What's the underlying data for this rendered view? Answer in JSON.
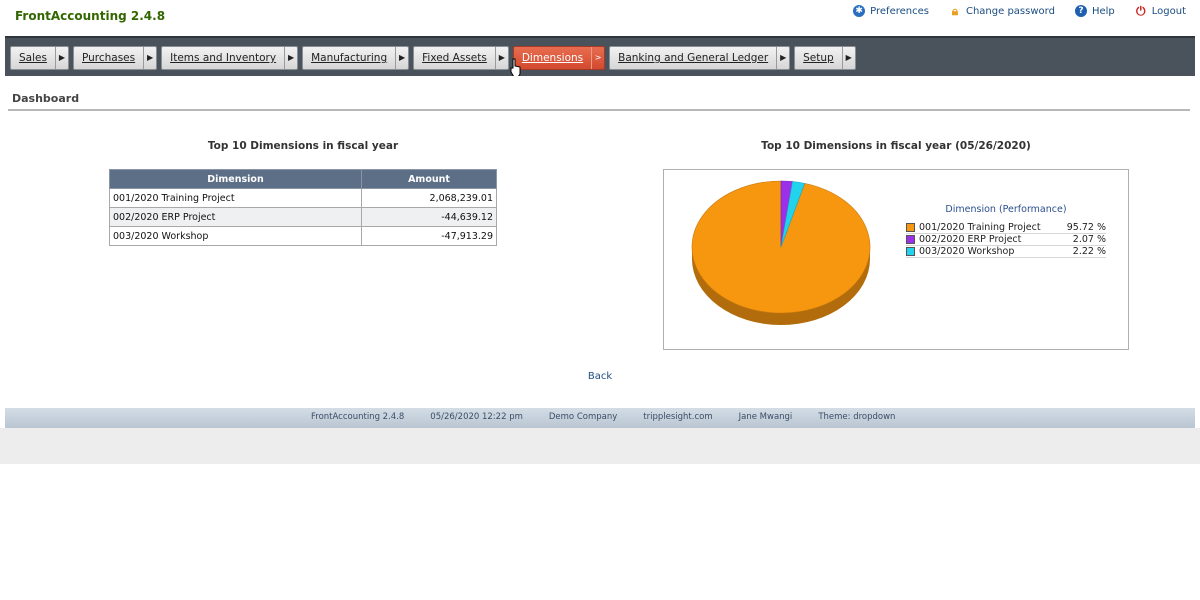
{
  "app": {
    "title": "FrontAccounting 2.4.8"
  },
  "top_links": [
    {
      "label": "Preferences",
      "icon": "gear-icon"
    },
    {
      "label": "Change password",
      "icon": "lock-icon"
    },
    {
      "label": "Help",
      "icon": "help-icon"
    },
    {
      "label": "Logout",
      "icon": "power-icon"
    }
  ],
  "nav": {
    "items": [
      {
        "label": "Sales"
      },
      {
        "label": "Purchases"
      },
      {
        "label": "Items and Inventory"
      },
      {
        "label": "Manufacturing"
      },
      {
        "label": "Fixed Assets"
      },
      {
        "label": "Dimensions",
        "active": true
      },
      {
        "label": "Banking and General Ledger"
      },
      {
        "label": "Setup"
      }
    ],
    "active_color": "#d9553a"
  },
  "page": {
    "title": "Dashboard"
  },
  "table": {
    "title": "Top 10 Dimensions in fiscal year",
    "headers": [
      "Dimension",
      "Amount"
    ],
    "rows": [
      {
        "dimension": "001/2020 Training Project",
        "amount": "2,068,239.01"
      },
      {
        "dimension": "002/2020 ERP Project",
        "amount": "-44,639.12"
      },
      {
        "dimension": "003/2020 Workshop",
        "amount": "-47,913.29"
      }
    ]
  },
  "chart": {
    "title": "Top 10 Dimensions in fiscal year (05/26/2020)",
    "legend_title": "Dimension (Performance)"
  },
  "chart_data": {
    "type": "pie",
    "title": "Top 10 Dimensions in fiscal year (05/26/2020)",
    "legend_title": "Dimension (Performance)",
    "legend_position": "right",
    "categories": [
      "001/2020 Training Project",
      "002/2020 ERP Project",
      "003/2020 Workshop"
    ],
    "values": [
      95.72,
      2.07,
      2.22
    ],
    "value_labels": [
      "95.72 %",
      "2.07 %",
      "2.22 %"
    ],
    "colors": [
      "#f7960f",
      "#9b30e8",
      "#22d3ee"
    ]
  },
  "back_link": {
    "label": "Back"
  },
  "footer": {
    "items": [
      "FrontAccounting 2.4.8",
      "05/26/2020 12:22 pm",
      "Demo Company",
      "tripplesight.com",
      "Jane Mwangi",
      "Theme: dropdown"
    ]
  }
}
